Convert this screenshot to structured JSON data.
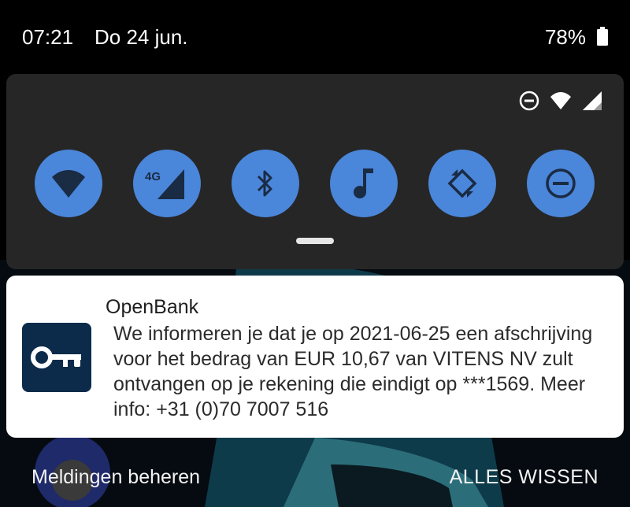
{
  "status_bar": {
    "time": "07:21",
    "date": "Do 24 jun.",
    "battery_percent": "78%",
    "battery_icon": "battery-icon"
  },
  "quick_settings": {
    "status_icons": [
      "do-not-disturb-icon",
      "wifi-icon",
      "cellular-signal-icon"
    ],
    "tiles": [
      {
        "name": "wifi",
        "icon": "wifi-icon",
        "active": true
      },
      {
        "name": "mobile-data",
        "icon": "mobile-data-4g-icon",
        "label_overlay": "4G",
        "active": true
      },
      {
        "name": "bluetooth",
        "icon": "bluetooth-icon",
        "active": true
      },
      {
        "name": "media",
        "icon": "music-note-icon",
        "active": true
      },
      {
        "name": "auto-rotate",
        "icon": "auto-rotate-icon",
        "active": true
      },
      {
        "name": "do-not-disturb",
        "icon": "do-not-disturb-icon",
        "active": true
      }
    ],
    "tile_color": "#4a86d9",
    "panel_color": "#262626"
  },
  "notification": {
    "app_name": "OpenBank",
    "app_icon": "key-icon",
    "app_icon_bg": "#0c2b4b",
    "text": "We informeren je dat je op 2021-06-25 een afschrijving voor het bedrag van EUR 10,67 van VITENS NV zult ontvangen op je rekening die eindigt op ***1569. Meer info: +31 (0)70 7007 516"
  },
  "actions": {
    "manage_label": "Meldingen beheren",
    "clear_all_label": "ALLES WISSEN"
  }
}
